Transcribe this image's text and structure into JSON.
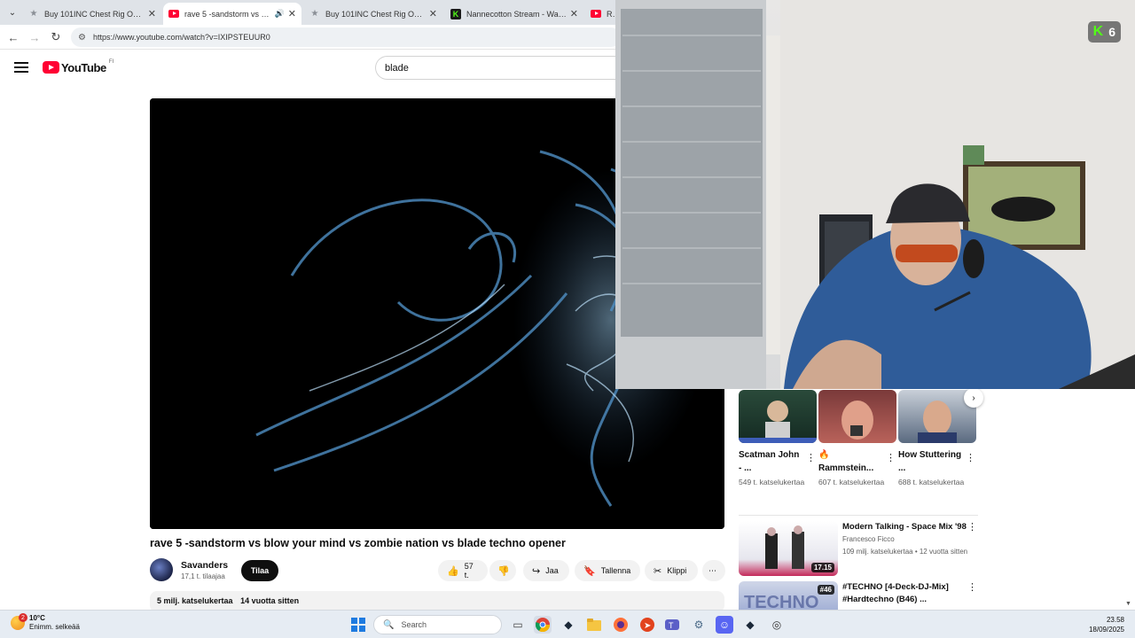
{
  "browser": {
    "tabs": [
      {
        "title": "Buy 101INC Chest Rig Operator",
        "icon": "star-icon"
      },
      {
        "title": "rave 5 -sandstorm vs blow",
        "icon": "youtube-icon",
        "active": true
      },
      {
        "title": "Buy 101INC Chest Rig Operator",
        "icon": "star-icon"
      },
      {
        "title": "Nannecotton Stream - Watch L",
        "icon": "kick-icon"
      },
      {
        "title": "RBS",
        "icon": "youtube-icon"
      }
    ],
    "url": "https://www.youtube.com/watch?v=IXIPSTEUUR0"
  },
  "youtube": {
    "logo_text": "YouTube",
    "region": "FI",
    "search_value": "blade",
    "video": {
      "title": "rave 5 -sandstorm vs blow your mind vs zombie nation vs blade techno opener",
      "channel": "Savanders",
      "subscribers": "17,1 t. tilaajaa",
      "subscribe_label": "Tilaa",
      "likes": "57 t.",
      "share_label": "Jaa",
      "save_label": "Tallenna",
      "clip_label": "Klippi",
      "views": "5 milj. katselukertaa",
      "age": "14 vuotta sitten"
    },
    "shorts": [
      {
        "title": "Scatman John - ...",
        "views": "549 t. katselukertaa"
      },
      {
        "title": "🔥 Rammstein...",
        "views": "607 t. katselukertaa"
      },
      {
        "title": "How Stuttering ...",
        "views": "688 t. katselukertaa"
      }
    ],
    "recommendations": [
      {
        "title": "Modern Talking - Space Mix '98",
        "channel": "Francesco Ficco",
        "meta": "109 milj. katselukertaa • 12 vuotta sitten",
        "duration": "17.15"
      },
      {
        "title": "#TECHNO [4-Deck-DJ-Mix] #Hardtechno (B46) ...",
        "channel": "",
        "meta": "",
        "duration": "#46"
      }
    ]
  },
  "stream_overlay": {
    "viewer_count": "6"
  },
  "taskbar": {
    "temperature": "10°C",
    "weather": "Enimm. selkeää",
    "weather_badge": "2",
    "search_placeholder": "Search",
    "time": "23.58",
    "date": "18/09/2025"
  },
  "colors": {
    "youtube_red": "#ff0033",
    "kick_green": "#53fc18",
    "taskbar_bg": "#e6ecf3"
  }
}
